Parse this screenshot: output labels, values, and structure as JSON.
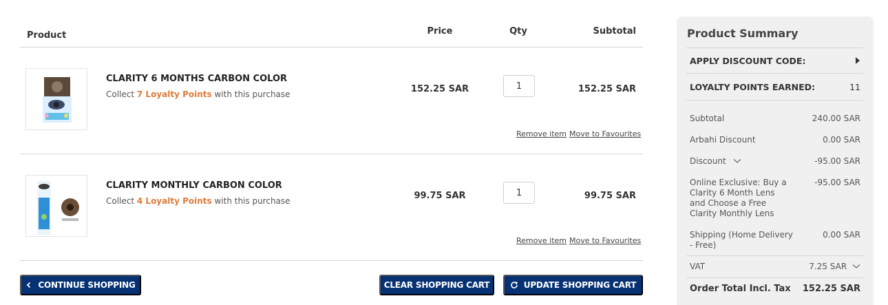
{
  "table": {
    "headers": {
      "product": "Product",
      "price": "Price",
      "qty": "Qty",
      "subtotal": "Subtotal"
    },
    "items": [
      {
        "name": "CLARITY 6 MONTHS CARBON COLOR",
        "loyalty_prefix": "Collect ",
        "loyalty_points": "7 Loyalty Points",
        "loyalty_suffix": " with this purchase",
        "price": "152.25 SAR",
        "qty": "1",
        "subtotal": "152.25 SAR",
        "remove_label": "Remove item",
        "favourite_label": "Move to Favourites"
      },
      {
        "name": "CLARITY MONTHLY CARBON COLOR",
        "loyalty_prefix": "Collect ",
        "loyalty_points": "4 Loyalty Points",
        "loyalty_suffix": " with this purchase",
        "price": "99.75 SAR",
        "qty": "1",
        "subtotal": "99.75 SAR",
        "remove_label": "Remove item",
        "favourite_label": "Move to Favourites"
      }
    ]
  },
  "actions": {
    "continue_label": "CONTINUE SHOPPING",
    "clear_label": "CLEAR SHOPPING CART",
    "update_label": "UPDATE SHOPPING CART"
  },
  "summary": {
    "title": "Product Summary",
    "discount_code_label": "APPLY DISCOUNT CODE:",
    "loyalty_label": "LOYALTY POINTS EARNED:",
    "loyalty_value": "11",
    "rows": [
      {
        "label": "Subtotal",
        "value": "240.00 SAR"
      },
      {
        "label": "Arbahi Discount",
        "value": "0.00 SAR"
      },
      {
        "label": "Discount",
        "value": "-95.00 SAR"
      },
      {
        "label": "Online Exclusive: Buy a Clarity 6 Month Lens and Choose a Free Clarity Monthly Lens",
        "value": "-95.00 SAR"
      },
      {
        "label": "Shipping (Home Delivery - Free)",
        "value": "0.00 SAR"
      },
      {
        "label": "VAT",
        "value": "7.25 SAR"
      }
    ],
    "total_label": "Order Total Incl. Tax",
    "total_value": "152.25 SAR"
  },
  "colors": {
    "brand": "#063274",
    "loyalty_accent": "#e07b39",
    "panel_bg": "#f0f0f0"
  },
  "icons": [
    "chevron-left-icon",
    "refresh-icon",
    "triangle-right-icon",
    "chevron-down-icon"
  ]
}
